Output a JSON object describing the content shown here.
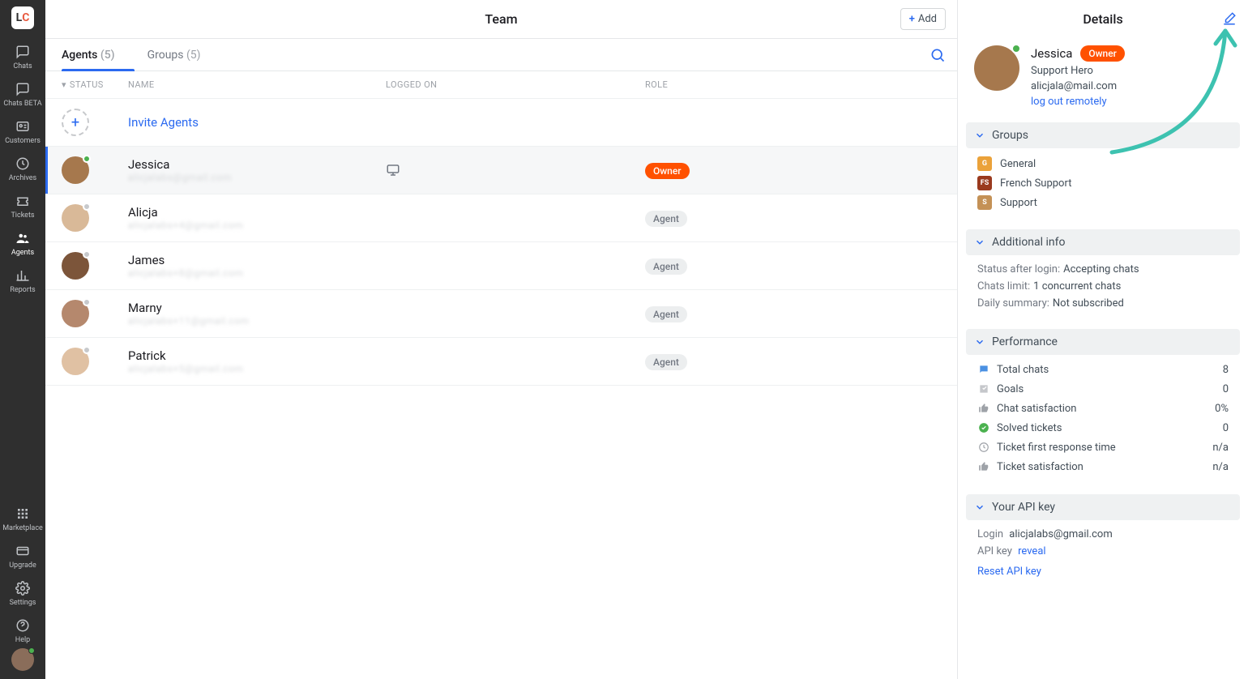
{
  "sidebar": {
    "items": [
      {
        "label": "Chats"
      },
      {
        "label": "Chats BETA"
      },
      {
        "label": "Customers"
      },
      {
        "label": "Archives"
      },
      {
        "label": "Tickets"
      },
      {
        "label": "Agents"
      },
      {
        "label": "Reports"
      }
    ],
    "bottom": [
      {
        "label": "Marketplace"
      },
      {
        "label": "Upgrade"
      },
      {
        "label": "Settings"
      },
      {
        "label": "Help"
      }
    ]
  },
  "page": {
    "title": "Team",
    "add_label": "Add"
  },
  "tabs": {
    "agents_label": "Agents",
    "agents_count": "(5)",
    "groups_label": "Groups",
    "groups_count": "(5)"
  },
  "columns": {
    "status": "STATUS",
    "name": "NAME",
    "logged": "LOGGED ON",
    "role": "ROLE"
  },
  "invite_label": "Invite Agents",
  "agents": [
    {
      "name": "Jessica",
      "email": "alicjalabs@gmail.com",
      "status": "online",
      "role": "Owner",
      "logged": "desktop",
      "selected": true,
      "avatar": "#a6784d"
    },
    {
      "name": "Alicja",
      "email": "alicjalabs+4@gmail.com",
      "status": "offline",
      "role": "Agent",
      "avatar": "#d9b998"
    },
    {
      "name": "James",
      "email": "alicjalabs+8@gmail.com",
      "status": "offline",
      "role": "Agent",
      "avatar": "#7c553a"
    },
    {
      "name": "Marny",
      "email": "alicjalabs+11@gmail.com",
      "status": "offline",
      "role": "Agent",
      "avatar": "#b5886d"
    },
    {
      "name": "Patrick",
      "email": "alicjalabs+5@gmail.com",
      "status": "offline",
      "role": "Agent",
      "avatar": "#e0c1a3"
    }
  ],
  "details": {
    "title": "Details",
    "name": "Jessica",
    "badge": "Owner",
    "role": "Support Hero",
    "email": "alicjala@mail.com",
    "logout_label": "log out remotely",
    "sections": {
      "groups_label": "Groups",
      "groups": [
        {
          "name": "General",
          "color": "#eba23a",
          "initial": "G"
        },
        {
          "name": "French Support",
          "color": "#9a3a1e",
          "initial": "FS"
        },
        {
          "name": "Support",
          "color": "#c49156",
          "initial": "S"
        }
      ],
      "additional_label": "Additional info",
      "additional": {
        "status_label": "Status after login:",
        "status_value": "Accepting chats",
        "limit_label": "Chats limit:",
        "limit_value": "1 concurrent chats",
        "summary_label": "Daily summary:",
        "summary_value": "Not subscribed"
      },
      "performance_label": "Performance",
      "performance": [
        {
          "icon": "chat",
          "label": "Total chats",
          "value": "8"
        },
        {
          "icon": "goal",
          "label": "Goals",
          "value": "0"
        },
        {
          "icon": "thumb",
          "label": "Chat satisfaction",
          "value": "0%"
        },
        {
          "icon": "check",
          "label": "Solved tickets",
          "value": "0"
        },
        {
          "icon": "clock",
          "label": "Ticket first response time",
          "value": "n/a"
        },
        {
          "icon": "thumb",
          "label": "Ticket satisfaction",
          "value": "n/a"
        }
      ],
      "api_label": "Your API key",
      "api": {
        "login_label": "Login",
        "login_value": "alicjalabs@gmail.com",
        "key_label": "API key",
        "reveal_label": "reveal",
        "reset_label": "Reset API key"
      }
    }
  }
}
